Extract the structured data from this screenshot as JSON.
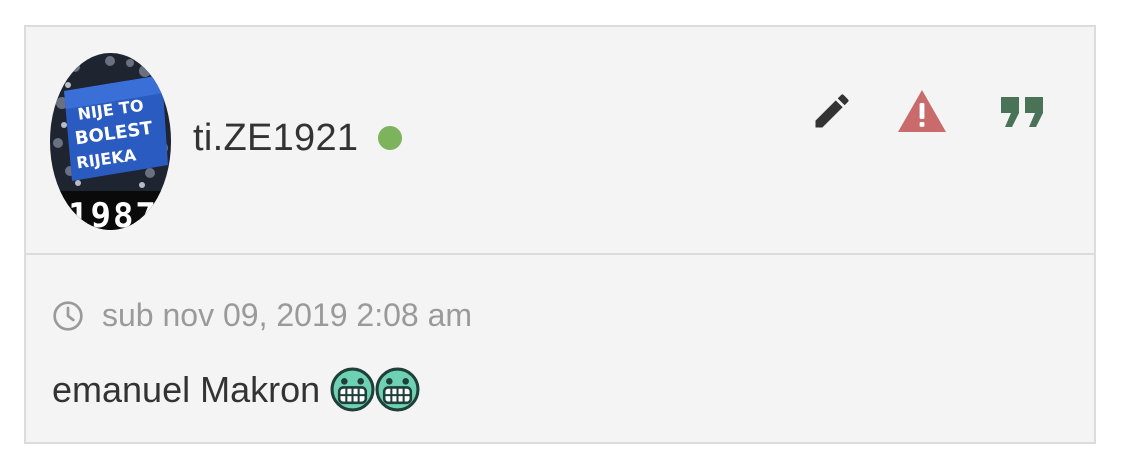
{
  "post": {
    "author": {
      "username": "ti.ZE1921",
      "online": true,
      "status_color": "#7cb35c"
    },
    "avatar": {
      "banner_lines": [
        "NIJE TO",
        "BOLEST",
        "RIJEKA"
      ],
      "number": "1987"
    },
    "actions": [
      {
        "name": "edit",
        "icon": "pencil-icon",
        "color": "#333333"
      },
      {
        "name": "report",
        "icon": "warning-icon",
        "color": "#c96b6b"
      },
      {
        "name": "quote",
        "icon": "quote-icon",
        "color": "#4a7257"
      }
    ],
    "timestamp": "sub nov 09, 2019 2:08 am",
    "content": {
      "text": "emanuel Makron",
      "smilies": [
        "grin-smiley",
        "grin-smiley"
      ]
    }
  }
}
